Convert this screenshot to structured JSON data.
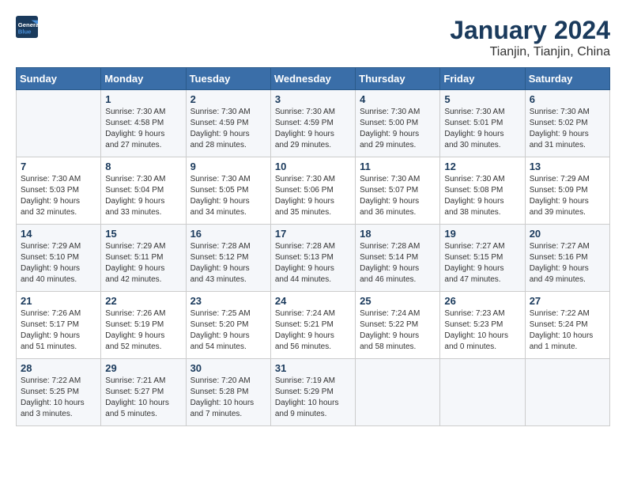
{
  "header": {
    "logo_line1": "General",
    "logo_line2": "Blue",
    "title": "January 2024",
    "location": "Tianjin, Tianjin, China"
  },
  "columns": [
    "Sunday",
    "Monday",
    "Tuesday",
    "Wednesday",
    "Thursday",
    "Friday",
    "Saturday"
  ],
  "weeks": [
    [
      {
        "day": "",
        "info": ""
      },
      {
        "day": "1",
        "info": "Sunrise: 7:30 AM\nSunset: 4:58 PM\nDaylight: 9 hours\nand 27 minutes."
      },
      {
        "day": "2",
        "info": "Sunrise: 7:30 AM\nSunset: 4:59 PM\nDaylight: 9 hours\nand 28 minutes."
      },
      {
        "day": "3",
        "info": "Sunrise: 7:30 AM\nSunset: 4:59 PM\nDaylight: 9 hours\nand 29 minutes."
      },
      {
        "day": "4",
        "info": "Sunrise: 7:30 AM\nSunset: 5:00 PM\nDaylight: 9 hours\nand 29 minutes."
      },
      {
        "day": "5",
        "info": "Sunrise: 7:30 AM\nSunset: 5:01 PM\nDaylight: 9 hours\nand 30 minutes."
      },
      {
        "day": "6",
        "info": "Sunrise: 7:30 AM\nSunset: 5:02 PM\nDaylight: 9 hours\nand 31 minutes."
      }
    ],
    [
      {
        "day": "7",
        "info": "Sunrise: 7:30 AM\nSunset: 5:03 PM\nDaylight: 9 hours\nand 32 minutes."
      },
      {
        "day": "8",
        "info": "Sunrise: 7:30 AM\nSunset: 5:04 PM\nDaylight: 9 hours\nand 33 minutes."
      },
      {
        "day": "9",
        "info": "Sunrise: 7:30 AM\nSunset: 5:05 PM\nDaylight: 9 hours\nand 34 minutes."
      },
      {
        "day": "10",
        "info": "Sunrise: 7:30 AM\nSunset: 5:06 PM\nDaylight: 9 hours\nand 35 minutes."
      },
      {
        "day": "11",
        "info": "Sunrise: 7:30 AM\nSunset: 5:07 PM\nDaylight: 9 hours\nand 36 minutes."
      },
      {
        "day": "12",
        "info": "Sunrise: 7:30 AM\nSunset: 5:08 PM\nDaylight: 9 hours\nand 38 minutes."
      },
      {
        "day": "13",
        "info": "Sunrise: 7:29 AM\nSunset: 5:09 PM\nDaylight: 9 hours\nand 39 minutes."
      }
    ],
    [
      {
        "day": "14",
        "info": "Sunrise: 7:29 AM\nSunset: 5:10 PM\nDaylight: 9 hours\nand 40 minutes."
      },
      {
        "day": "15",
        "info": "Sunrise: 7:29 AM\nSunset: 5:11 PM\nDaylight: 9 hours\nand 42 minutes."
      },
      {
        "day": "16",
        "info": "Sunrise: 7:28 AM\nSunset: 5:12 PM\nDaylight: 9 hours\nand 43 minutes."
      },
      {
        "day": "17",
        "info": "Sunrise: 7:28 AM\nSunset: 5:13 PM\nDaylight: 9 hours\nand 44 minutes."
      },
      {
        "day": "18",
        "info": "Sunrise: 7:28 AM\nSunset: 5:14 PM\nDaylight: 9 hours\nand 46 minutes."
      },
      {
        "day": "19",
        "info": "Sunrise: 7:27 AM\nSunset: 5:15 PM\nDaylight: 9 hours\nand 47 minutes."
      },
      {
        "day": "20",
        "info": "Sunrise: 7:27 AM\nSunset: 5:16 PM\nDaylight: 9 hours\nand 49 minutes."
      }
    ],
    [
      {
        "day": "21",
        "info": "Sunrise: 7:26 AM\nSunset: 5:17 PM\nDaylight: 9 hours\nand 51 minutes."
      },
      {
        "day": "22",
        "info": "Sunrise: 7:26 AM\nSunset: 5:19 PM\nDaylight: 9 hours\nand 52 minutes."
      },
      {
        "day": "23",
        "info": "Sunrise: 7:25 AM\nSunset: 5:20 PM\nDaylight: 9 hours\nand 54 minutes."
      },
      {
        "day": "24",
        "info": "Sunrise: 7:24 AM\nSunset: 5:21 PM\nDaylight: 9 hours\nand 56 minutes."
      },
      {
        "day": "25",
        "info": "Sunrise: 7:24 AM\nSunset: 5:22 PM\nDaylight: 9 hours\nand 58 minutes."
      },
      {
        "day": "26",
        "info": "Sunrise: 7:23 AM\nSunset: 5:23 PM\nDaylight: 10 hours\nand 0 minutes."
      },
      {
        "day": "27",
        "info": "Sunrise: 7:22 AM\nSunset: 5:24 PM\nDaylight: 10 hours\nand 1 minute."
      }
    ],
    [
      {
        "day": "28",
        "info": "Sunrise: 7:22 AM\nSunset: 5:25 PM\nDaylight: 10 hours\nand 3 minutes."
      },
      {
        "day": "29",
        "info": "Sunrise: 7:21 AM\nSunset: 5:27 PM\nDaylight: 10 hours\nand 5 minutes."
      },
      {
        "day": "30",
        "info": "Sunrise: 7:20 AM\nSunset: 5:28 PM\nDaylight: 10 hours\nand 7 minutes."
      },
      {
        "day": "31",
        "info": "Sunrise: 7:19 AM\nSunset: 5:29 PM\nDaylight: 10 hours\nand 9 minutes."
      },
      {
        "day": "",
        "info": ""
      },
      {
        "day": "",
        "info": ""
      },
      {
        "day": "",
        "info": ""
      }
    ]
  ]
}
